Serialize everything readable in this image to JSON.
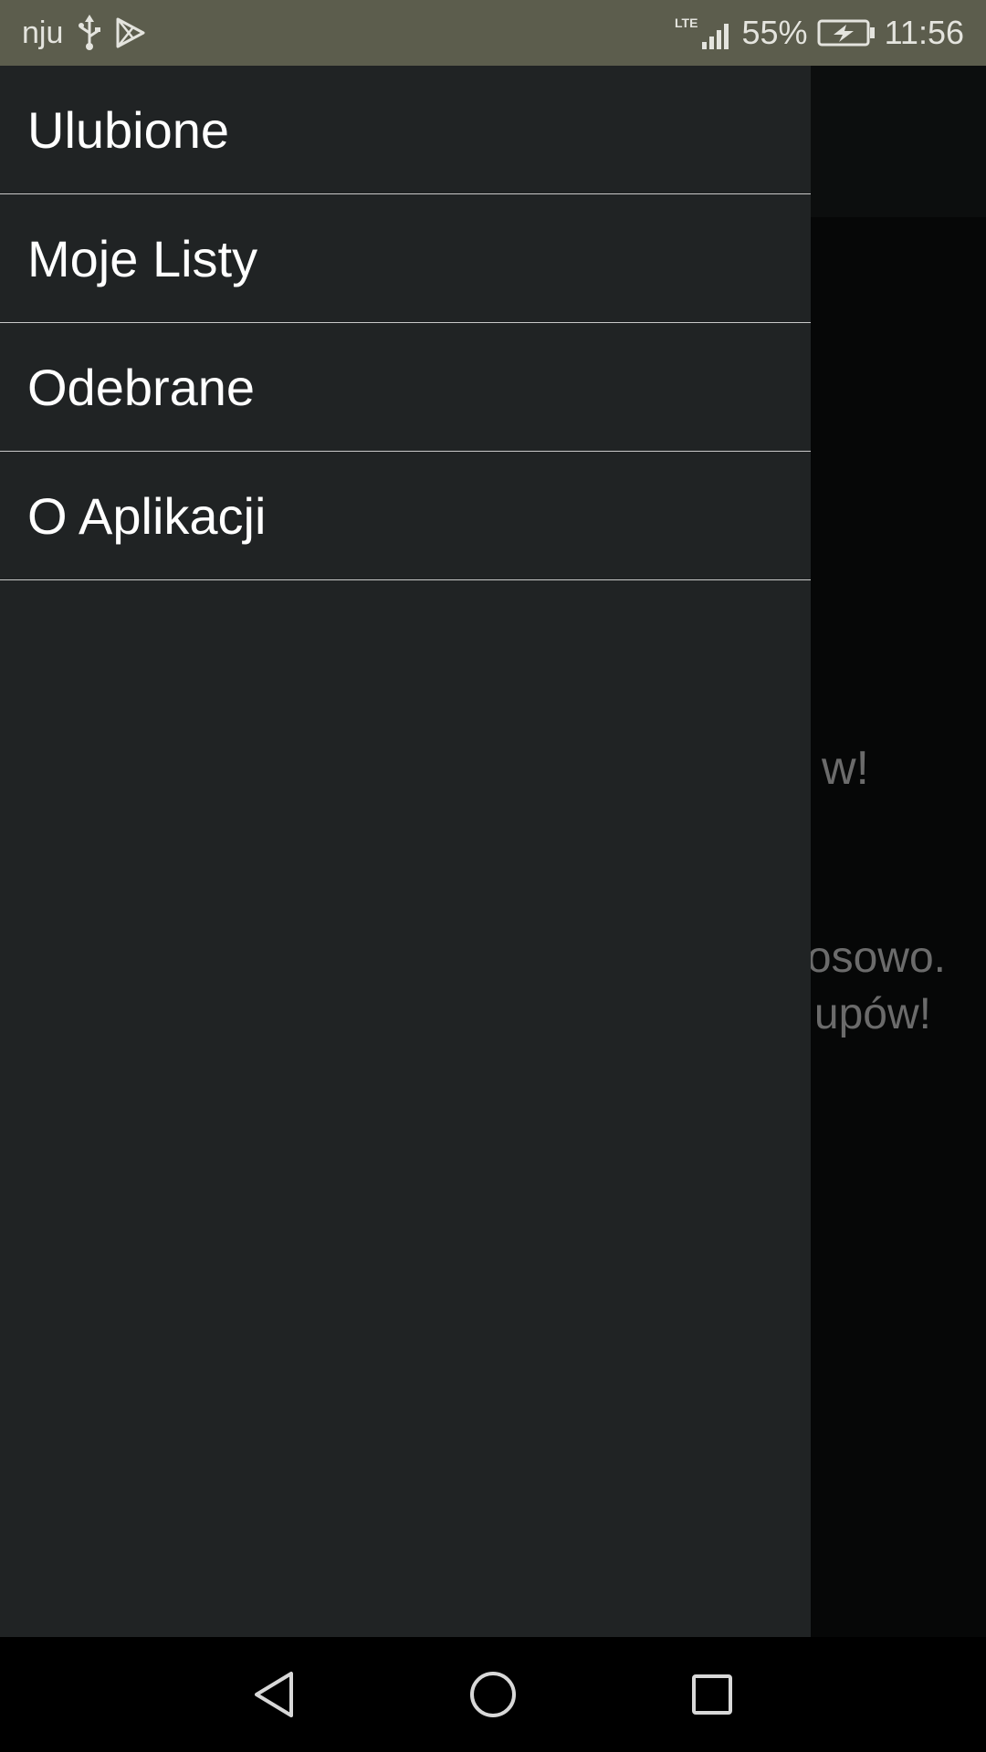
{
  "status_bar": {
    "carrier": "nju",
    "network_type": "LTE",
    "battery": "55%",
    "time": "11:56",
    "icons": [
      "usb-icon",
      "play-store-icon",
      "signal-icon",
      "battery-charging-icon"
    ]
  },
  "background_screen": {
    "heading_fragment": "w!",
    "line1_fragment": "osowo.",
    "line2_fragment": "upów!"
  },
  "drawer": {
    "items": [
      {
        "label": "Ulubione"
      },
      {
        "label": "Moje Listy"
      },
      {
        "label": "Odebrane"
      },
      {
        "label": "O Aplikacji"
      }
    ]
  },
  "nav_bar": {
    "buttons": [
      "back-icon",
      "home-icon",
      "recent-apps-icon"
    ]
  }
}
